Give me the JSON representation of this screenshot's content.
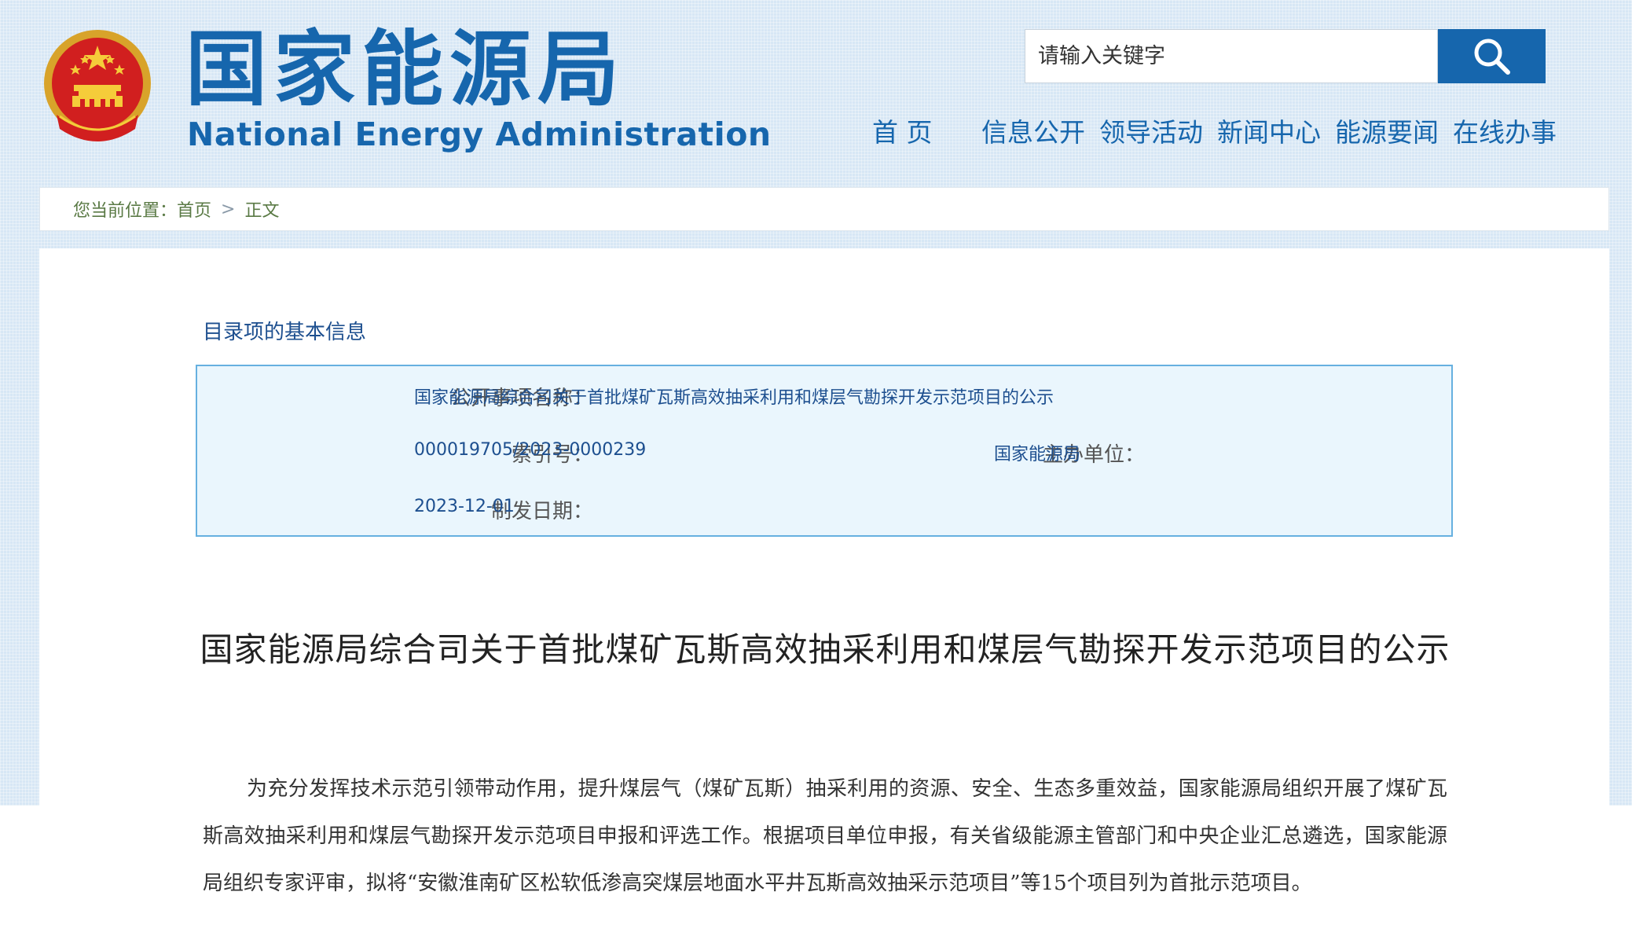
{
  "header": {
    "site_title": "国家能源局",
    "site_subtitle": "National Energy Administration",
    "emblem_icon": "national-emblem-icon",
    "search": {
      "placeholder": "请输入关键字",
      "button_icon": "search-icon"
    },
    "nav": [
      {
        "label": "首 页"
      },
      {
        "label": "信息公开"
      },
      {
        "label": "领导活动"
      },
      {
        "label": "新闻中心"
      },
      {
        "label": "能源要闻"
      },
      {
        "label": "在线办事"
      }
    ]
  },
  "breadcrumb": {
    "prefix": "您当前位置：",
    "items": [
      "首页",
      "正文"
    ],
    "separator": ">"
  },
  "info": {
    "heading": "目录项的基本信息",
    "name_label": "公开事项名称：",
    "name_value": "国家能源局综合司关于首批煤矿瓦斯高效抽采利用和煤层气勘探开发示范项目的公示",
    "index_label": "索引号：",
    "index_value": "000019705/2023-0000239",
    "org_label": "主办单位：",
    "org_value": "国家能源局",
    "date_label": "制发日期：",
    "date_value": "2023-12-01"
  },
  "article": {
    "title": "国家能源局综合司关于首批煤矿瓦斯高效抽采利用和煤层气勘探开发示范项目的公示",
    "body": "为充分发挥技术示范引领带动作用，提升煤层气（煤矿瓦斯）抽采利用的资源、安全、生态多重效益，国家能源局组织开展了煤矿瓦斯高效抽采利用和煤层气勘探开发示范项目申报和评选工作。根据项目单位申报，有关省级能源主管部门和中央企业汇总遴选，国家能源局组织专家评审，拟将“安徽淮南矿区松软低渗高突煤层地面水平井瓦斯高效抽采示范项目”等15个项目列为首批示范项目。"
  },
  "colors": {
    "brand_blue": "#1666ad",
    "info_box_bg": "#eaf6fd",
    "info_box_border": "#66b0e0",
    "breadcrumb_text": "#5a7a45"
  }
}
